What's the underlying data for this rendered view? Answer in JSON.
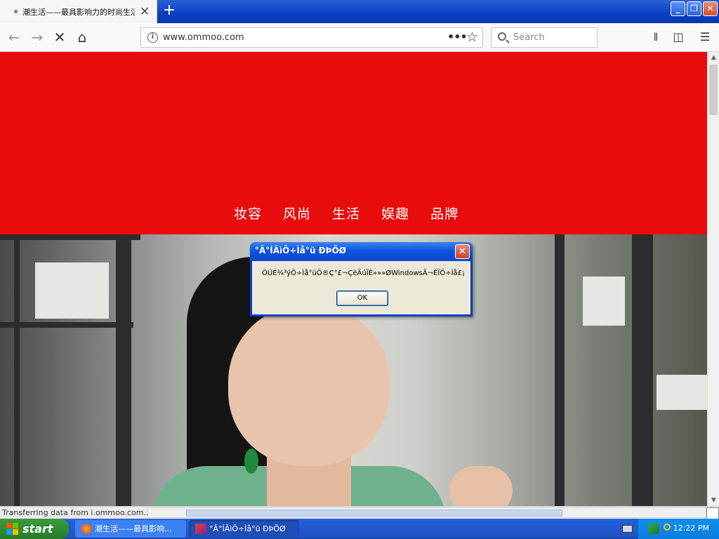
{
  "browser": {
    "tab_title": "潮生活——最具影响力的时尚生活",
    "new_tab_symbol": "+",
    "url": "www.ommoo.com",
    "search_placeholder": "Search"
  },
  "page": {
    "nav_items": [
      "妆容",
      "风尚",
      "生活",
      "娱趣",
      "品牌"
    ],
    "banner_color": "#e90c0c"
  },
  "status": {
    "text": "Transferring data from i.ommoo.com..."
  },
  "dialog": {
    "title": "°Â°ÍÂìÖ÷Ìå°ü ÐÞÕØ",
    "message": "ÔÚÉ¾³ýÖ÷Ìå°üÖ®Ç°£¬ÇëÄúÏÈ»»»ØWindowsÄ¬ÈÏÖ÷Ìå£¡",
    "ok_label": "OK"
  },
  "taskbar": {
    "start_label": "start",
    "tasks": [
      {
        "label": "潮生活——最具影响..."
      },
      {
        "label": "°Â°ÍÂìÖ÷Ìå°ü ÐÞÕØ"
      }
    ],
    "clock": "12:22 PM"
  },
  "colors": {
    "xp_blue": "#0a44cb",
    "start_green": "#2f8a2f",
    "tray_blue": "#0a7de0"
  },
  "icons": [
    "back-icon",
    "forward-icon",
    "stop-icon",
    "home-icon",
    "info-icon",
    "more-icon",
    "bookmark-star-icon",
    "search-icon",
    "library-icon",
    "sidebar-icon",
    "menu-icon"
  ]
}
